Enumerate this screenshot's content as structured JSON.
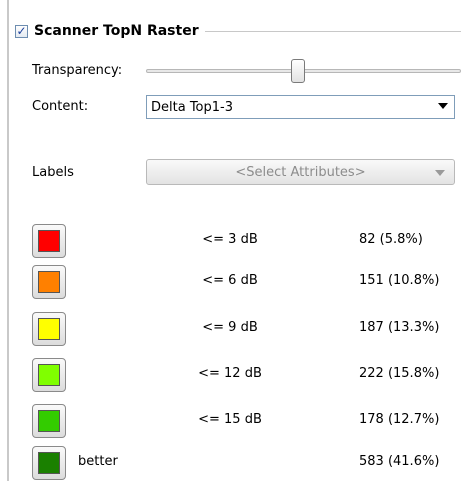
{
  "group": {
    "checked": true,
    "check_glyph": "✓",
    "title": "Scanner TopN Raster"
  },
  "transparency": {
    "label": "Transparency:",
    "value_percent": 48
  },
  "content": {
    "label": "Content:",
    "selected": "Delta Top1-3"
  },
  "labels": {
    "label": "Labels",
    "placeholder": "<Select Attributes>"
  },
  "legend": [
    {
      "color": "#ff0000",
      "range": "<= 3 dB",
      "label": "",
      "count": "82 (5.8%)"
    },
    {
      "color": "#ff8000",
      "range": "<= 6 dB",
      "label": "",
      "count": "151 (10.8%)"
    },
    {
      "color": "#ffff00",
      "range": "<= 9 dB",
      "label": "",
      "count": "187 (13.3%)"
    },
    {
      "color": "#80ff00",
      "range": "<= 12 dB",
      "label": "",
      "count": "222 (15.8%)"
    },
    {
      "color": "#33cc00",
      "range": "<= 15 dB",
      "label": "",
      "count": "178 (12.7%)"
    },
    {
      "color": "#1a8000",
      "range": "",
      "label": "better",
      "count": "583 (41.6%)"
    }
  ]
}
